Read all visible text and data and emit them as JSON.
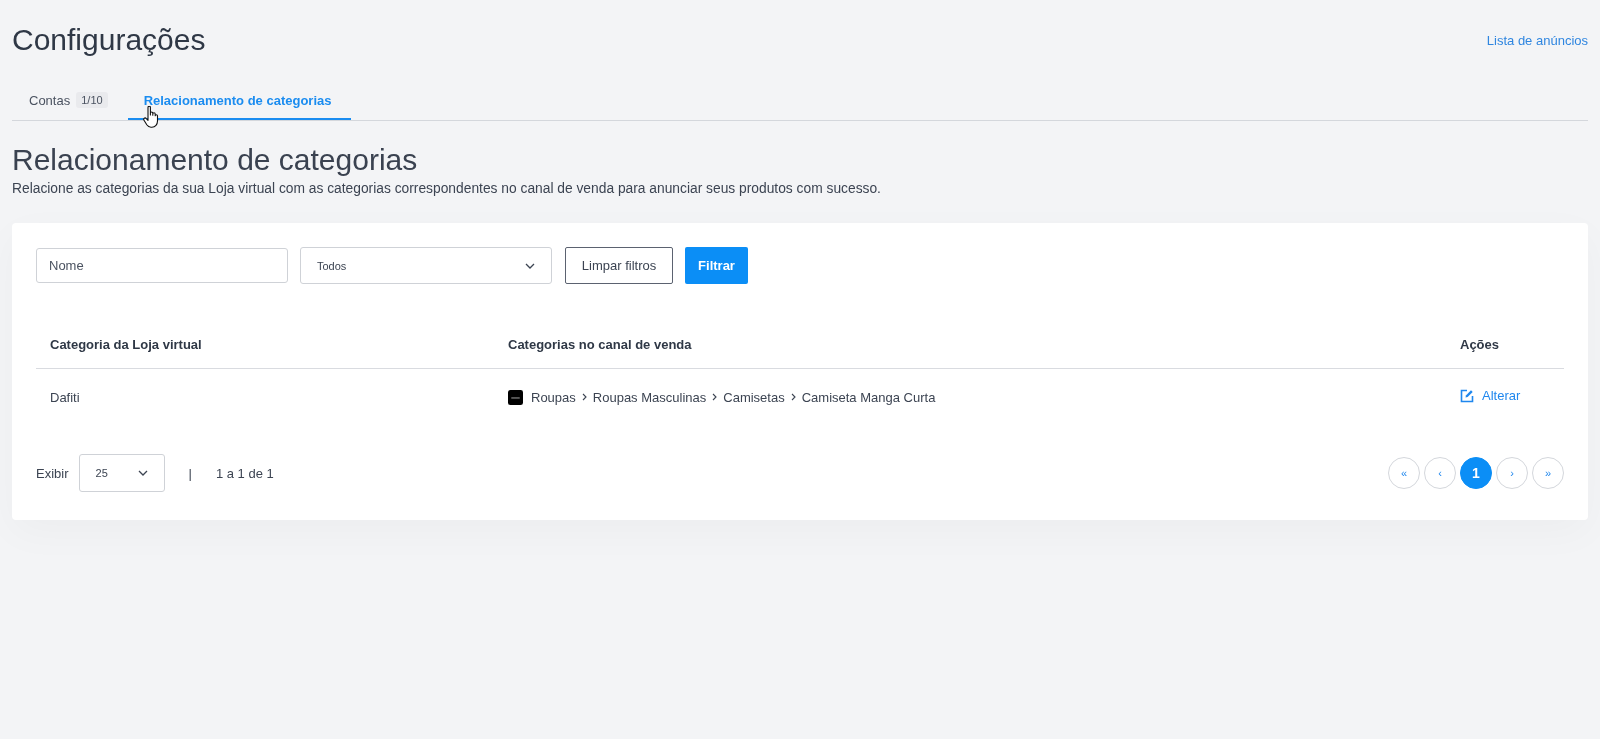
{
  "page": {
    "title": "Configurações",
    "link": "Lista de anúncios"
  },
  "tabs": [
    {
      "label": "Contas",
      "badge": "1/10",
      "selected": false
    },
    {
      "label": "Relacionamento de categorias",
      "selected": true
    }
  ],
  "section": {
    "title": "Relacionamento de categorias",
    "description": "Relacione as categorias da sua Loja virtual com as categorias correspondentes no canal de venda para anunciar seus produtos com sucesso."
  },
  "filters": {
    "name_field": {
      "placeholder": "Nome"
    },
    "status_select": {
      "value": "Todos"
    },
    "buttons": [
      {
        "label": "Limpar filtros",
        "kind": "outline"
      },
      {
        "label": "Filtrar",
        "kind": "primary"
      }
    ]
  },
  "table": {
    "columns": [
      "Categoria da Loja virtual",
      "Categorias no canal de venda",
      "Ações"
    ],
    "rows": [
      {
        "store_category": "Dafiti",
        "channel_path": [
          "Roupas",
          "Roupas Masculinas",
          "Camisetas",
          "Camiseta Manga Curta"
        ],
        "action": "Alterar"
      }
    ]
  },
  "footer": {
    "page_size_label": "Exibir",
    "page_size": "25",
    "separator": "|",
    "range": "1 a 1 de 1"
  },
  "pagination": [
    {
      "label": "«",
      "selected": false
    },
    {
      "label": "‹",
      "selected": false
    },
    {
      "label": "1",
      "selected": true
    },
    {
      "label": "›",
      "selected": false
    },
    {
      "label": "»",
      "selected": false
    }
  ]
}
